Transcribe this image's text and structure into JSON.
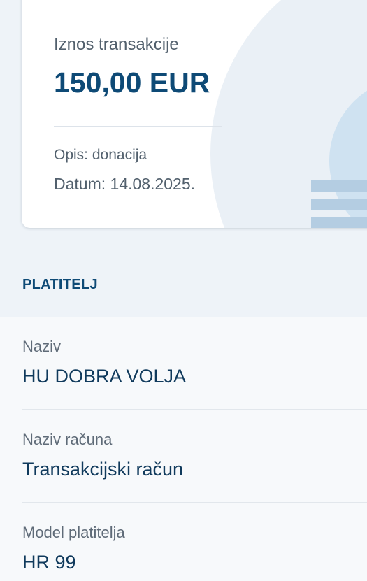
{
  "transaction": {
    "amount_label": "Iznos transakcije",
    "amount": "150,00 EUR",
    "description": "Opis: donacija",
    "date": "Datum: 14.08.2025."
  },
  "payer_section": {
    "title": "PLATITELJ",
    "fields": [
      {
        "label": "Naziv",
        "value": "HU DOBRA VOLJA"
      },
      {
        "label": "Naziv računa",
        "value": "Transakcijski račun"
      },
      {
        "label": "Model platitelja",
        "value": "HR 99"
      }
    ]
  },
  "colors": {
    "brand_blue": "#0e4a76",
    "background": "#eef3f8",
    "card": "#ffffff"
  }
}
